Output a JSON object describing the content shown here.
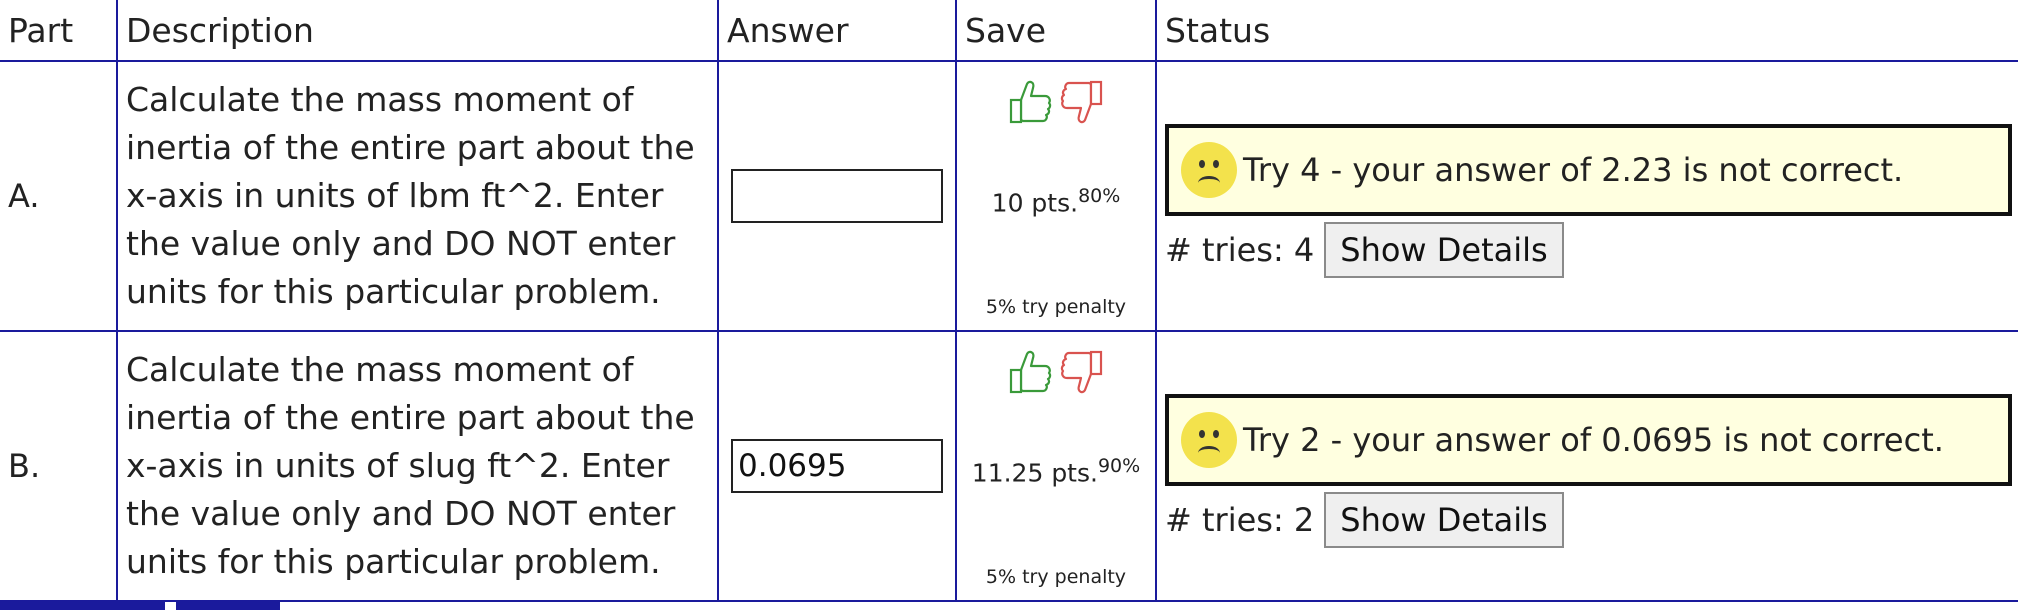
{
  "headers": {
    "part": "Part",
    "description": "Description",
    "answer": "Answer",
    "save": "Save",
    "status": "Status"
  },
  "rows": [
    {
      "part": "A.",
      "description": "Calculate the mass moment of inertia of the entire part about the x-axis in units of lbm ft^2. Enter the value only and DO NOT enter units for this particular problem.",
      "answer_value": "",
      "points": "10 pts.",
      "percent": "80%",
      "penalty": "5% try penalty",
      "status_message": "Try 4 - your answer of 2.23 is not correct.",
      "tries_label": "# tries: 4",
      "show_details_label": "Show Details"
    },
    {
      "part": "B.",
      "description": "Calculate the mass moment of inertia of the entire part about the x-axis in units of slug ft^2. Enter the value only and DO NOT enter units for this particular problem.",
      "answer_value": "0.0695",
      "points": "11.25 pts.",
      "percent": "90%",
      "penalty": "5% try penalty",
      "status_message": "Try 2 - your answer of 0.0695 is not correct.",
      "tries_label": "# tries: 2",
      "show_details_label": "Show Details"
    }
  ],
  "colors": {
    "border": "#1a1a9c",
    "status_bg": "#ffffe0",
    "thumb_up": "#3a9a3a",
    "thumb_down": "#d9534f",
    "sad_face": "#f3e24c"
  },
  "icons": {
    "thumb_up": "thumbs-up-icon",
    "thumb_down": "thumbs-down-icon",
    "status": "sad-face-icon"
  }
}
